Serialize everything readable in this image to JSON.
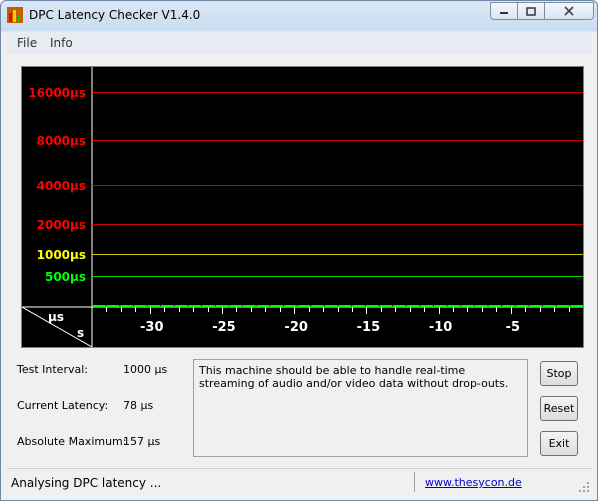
{
  "window": {
    "title": "DPC Latency Checker V1.4.0",
    "icon": "app-bars-icon"
  },
  "menu": [
    "File",
    "Info"
  ],
  "graph": {
    "y_unit": "µs",
    "x_unit": "s",
    "y_labels": [
      {
        "text": "16000µs",
        "color": "#ff0000"
      },
      {
        "text": "8000µs",
        "color": "#ff0000"
      },
      {
        "text": "4000µs",
        "color": "#ff0000"
      },
      {
        "text": "2000µs",
        "color": "#ff0000"
      },
      {
        "text": "1000µs",
        "color": "#ffff00"
      },
      {
        "text": "500µs",
        "color": "#00ff00"
      }
    ],
    "x_labels": [
      "-30",
      "-25",
      "-20",
      "-15",
      "-10",
      "-5"
    ],
    "bar_color": "#00ff00",
    "bars": [
      78,
      78,
      78,
      78,
      78,
      78,
      78,
      78,
      78,
      78,
      78,
      78,
      78,
      78,
      78,
      78,
      78,
      78,
      78,
      78,
      78,
      78,
      78,
      78,
      78,
      78,
      78,
      78,
      78,
      78,
      78,
      78,
      78,
      78,
      78,
      78
    ]
  },
  "chart_data": {
    "type": "bar",
    "title": "",
    "xlabel": "s",
    "ylabel": "µs",
    "y_scale": "log2",
    "y_ticks": [
      500,
      1000,
      2000,
      4000,
      8000,
      16000
    ],
    "x_ticks": [
      -30,
      -25,
      -20,
      -15,
      -10,
      -5
    ],
    "xlim": [
      -34,
      0
    ],
    "series": [
      {
        "values": [
          88,
          62,
          60,
          60,
          60,
          70,
          70,
          62,
          60,
          56,
          70,
          70,
          66,
          60,
          52,
          56,
          60,
          60,
          60,
          52,
          56,
          56,
          56,
          52,
          60,
          66,
          76,
          62,
          56,
          56,
          52,
          56,
          56,
          56,
          52,
          78
        ]
      }
    ]
  },
  "info": {
    "test_interval_label": "Test Interval:",
    "test_interval_value": "1000 µs",
    "current_latency_label": "Current Latency:",
    "current_latency_value": "78 µs",
    "absolute_max_label": "Absolute Maximum:",
    "absolute_max_value": "157 µs"
  },
  "message": "This machine should be able to handle real-time streaming of audio and/or video data without drop-outs.",
  "buttons": {
    "stop": "Stop",
    "reset": "Reset",
    "exit": "Exit"
  },
  "status": {
    "text": "Analysing DPC latency ...",
    "link": "www.thesycon.de"
  }
}
